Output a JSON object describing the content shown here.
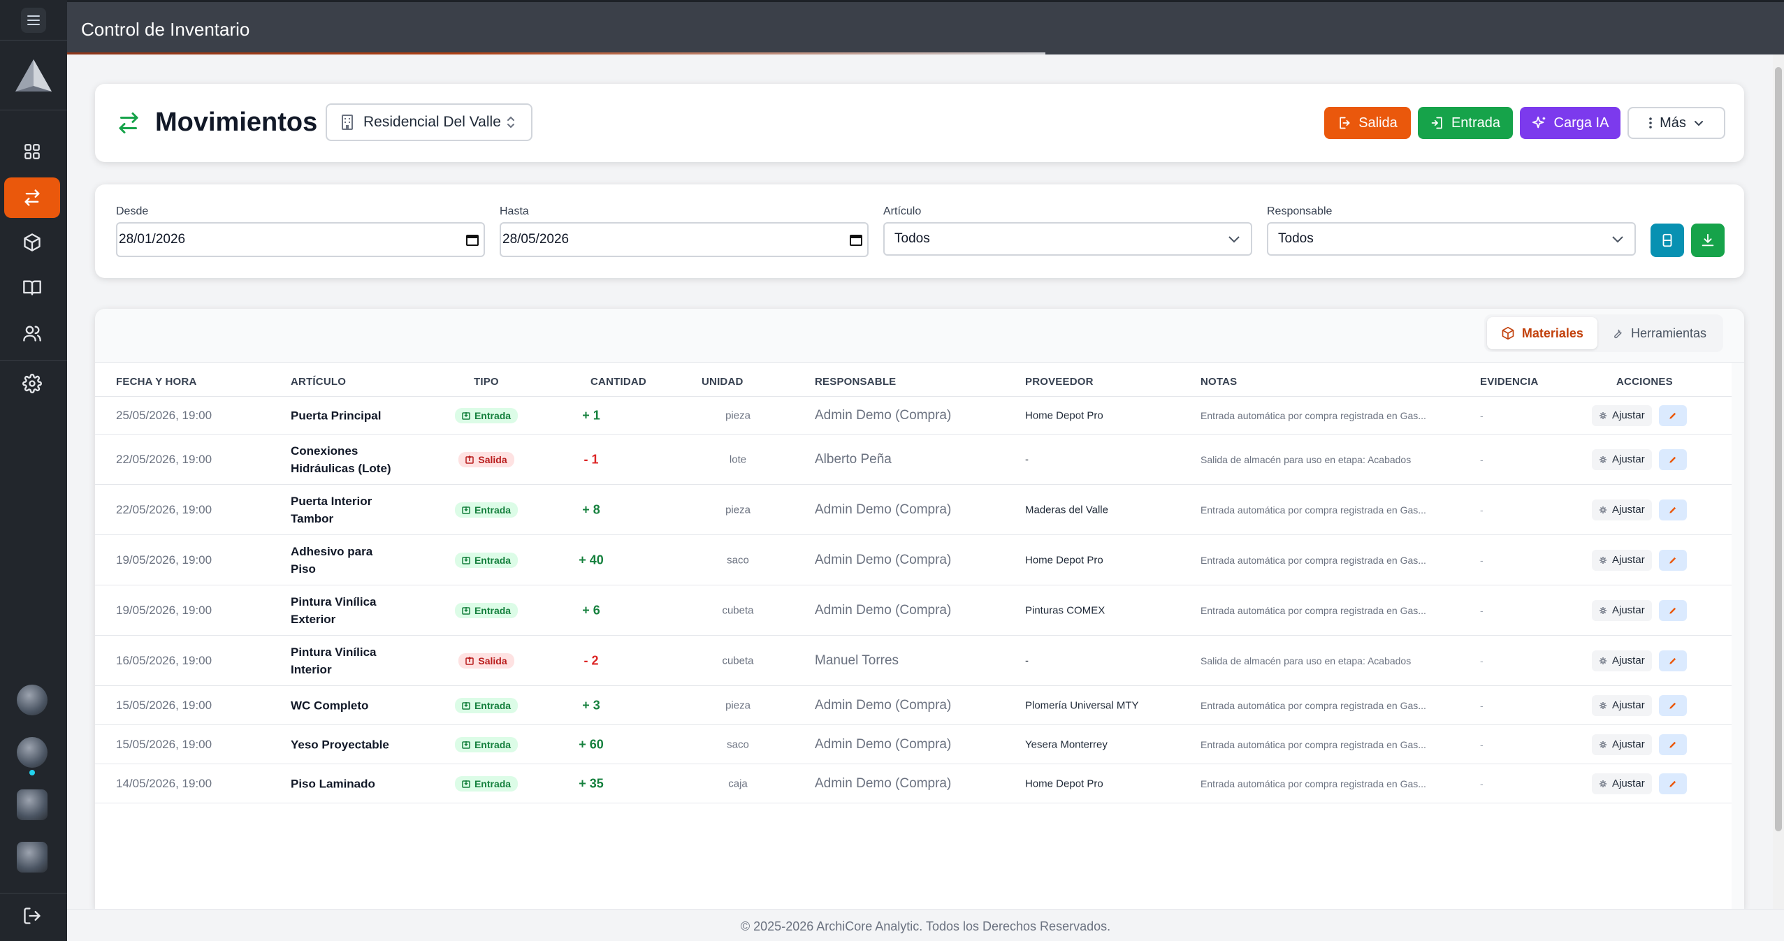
{
  "app": {
    "title": "Control de Inventario"
  },
  "sidebar": {
    "items": [
      {
        "icon": "dashboard-icon"
      },
      {
        "icon": "transfer-arrows-icon",
        "active": true
      },
      {
        "icon": "box-icon"
      },
      {
        "icon": "book-icon"
      },
      {
        "icon": "users-icon"
      },
      {
        "icon": "gear-icon"
      }
    ],
    "logout_icon": "logout-icon"
  },
  "header": {
    "title": "Movimientos",
    "project": "Residencial Del Valle",
    "buttons": {
      "salida": "Salida",
      "entrada": "Entrada",
      "carga": "Carga IA",
      "mas": "Más"
    }
  },
  "filters": {
    "desde": {
      "label": "Desde",
      "value": "28/01/2026"
    },
    "hasta": {
      "label": "Hasta",
      "value": "28/05/2026"
    },
    "articulo": {
      "label": "Artículo",
      "value": "Todos"
    },
    "responsable": {
      "label": "Responsable",
      "value": "Todos"
    }
  },
  "tabs": {
    "materiales": "Materiales",
    "herramientas": "Herramientas"
  },
  "table": {
    "headers": [
      "FECHA Y HORA",
      "ARTÍCULO",
      "TIPO",
      "CANTIDAD",
      "UNIDAD",
      "RESPONSABLE",
      "PROVEEDOR",
      "NOTAS",
      "EVIDENCIA",
      "ACCIONES"
    ],
    "adjust_label": "Ajustar",
    "rows": [
      {
        "fecha": "25/05/2026, 19:00",
        "articulo": "Puerta Principal",
        "tipo": "Entrada",
        "cantidad": "+ 1",
        "unidad": "pieza",
        "responsable": "Admin Demo (Compra)",
        "proveedor": "Home Depot Pro",
        "notas": "Entrada automática por compra registrada en Gas...",
        "evidencia": "-"
      },
      {
        "fecha": "22/05/2026, 19:00",
        "articulo": "Conexiones Hidráulicas (Lote)",
        "tipo": "Salida",
        "cantidad": "- 1",
        "unidad": "lote",
        "responsable": "Alberto Peña",
        "proveedor": "-",
        "notas": "Salida de almacén para uso en etapa: Acabados",
        "evidencia": "-"
      },
      {
        "fecha": "22/05/2026, 19:00",
        "articulo": "Puerta Interior Tambor",
        "tipo": "Entrada",
        "cantidad": "+ 8",
        "unidad": "pieza",
        "responsable": "Admin Demo (Compra)",
        "proveedor": "Maderas del Valle",
        "notas": "Entrada automática por compra registrada en Gas...",
        "evidencia": "-"
      },
      {
        "fecha": "19/05/2026, 19:00",
        "articulo": "Adhesivo para Piso",
        "tipo": "Entrada",
        "cantidad": "+ 40",
        "unidad": "saco",
        "responsable": "Admin Demo (Compra)",
        "proveedor": "Home Depot Pro",
        "notas": "Entrada automática por compra registrada en Gas...",
        "evidencia": "-"
      },
      {
        "fecha": "19/05/2026, 19:00",
        "articulo": "Pintura Vinílica Exterior",
        "tipo": "Entrada",
        "cantidad": "+ 6",
        "unidad": "cubeta",
        "responsable": "Admin Demo (Compra)",
        "proveedor": "Pinturas COMEX",
        "notas": "Entrada automática por compra registrada en Gas...",
        "evidencia": "-"
      },
      {
        "fecha": "16/05/2026, 19:00",
        "articulo": "Pintura Vinílica Interior",
        "tipo": "Salida",
        "cantidad": "- 2",
        "unidad": "cubeta",
        "responsable": "Manuel Torres",
        "proveedor": "-",
        "notas": "Salida de almacén para uso en etapa: Acabados",
        "evidencia": "-"
      },
      {
        "fecha": "15/05/2026, 19:00",
        "articulo": "WC Completo",
        "tipo": "Entrada",
        "cantidad": "+ 3",
        "unidad": "pieza",
        "responsable": "Admin Demo (Compra)",
        "proveedor": "Plomería Universal MTY",
        "notas": "Entrada automática por compra registrada en Gas...",
        "evidencia": "-"
      },
      {
        "fecha": "15/05/2026, 19:00",
        "articulo": "Yeso Proyectable",
        "tipo": "Entrada",
        "cantidad": "+ 60",
        "unidad": "saco",
        "responsable": "Admin Demo (Compra)",
        "proveedor": "Yesera Monterrey",
        "notas": "Entrada automática por compra registrada en Gas...",
        "evidencia": "-"
      },
      {
        "fecha": "14/05/2026, 19:00",
        "articulo": "Piso Laminado",
        "tipo": "Entrada",
        "cantidad": "+ 35",
        "unidad": "caja",
        "responsable": "Admin Demo (Compra)",
        "proveedor": "Home Depot Pro",
        "notas": "Entrada automática por compra registrada en Gas...",
        "evidencia": "-"
      }
    ]
  },
  "footer": {
    "text": "© 2025-2026 ArchiCore Analytic. Todos los Derechos Reservados."
  },
  "colors": {
    "accent": "#ea580c",
    "entrada": "#16a34a",
    "carga": "#7c3aed",
    "sidebar": "#22262c"
  }
}
